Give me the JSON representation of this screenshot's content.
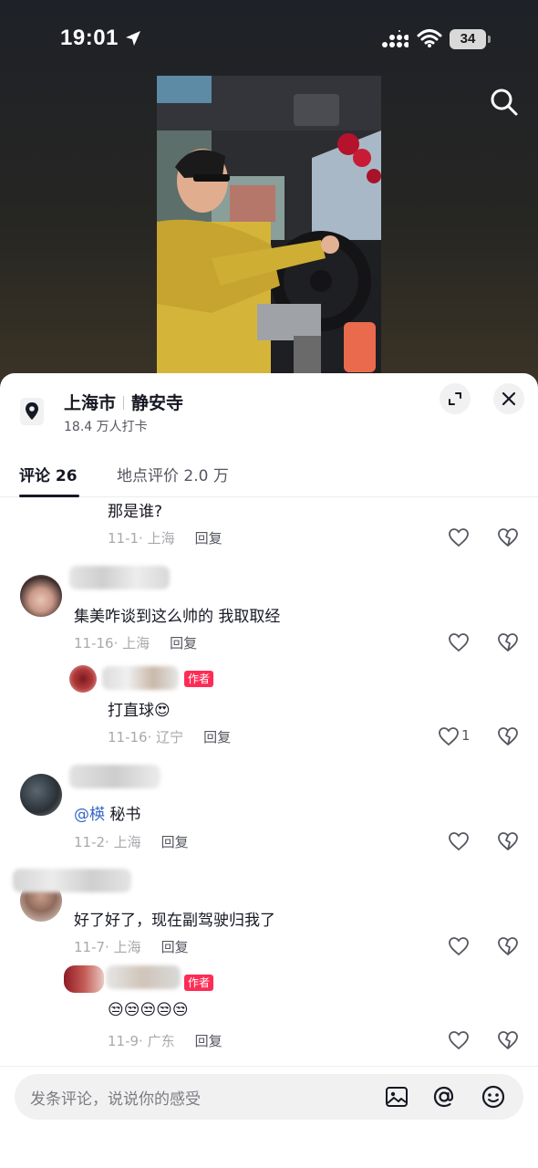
{
  "status": {
    "time": "19:01",
    "battery": "34"
  },
  "location": {
    "city": "上海市",
    "place": "静安寺",
    "checkins": "18.4 万人打卡"
  },
  "tabs": [
    {
      "label": "评论 26",
      "active": true
    },
    {
      "label": "地点评价 2.0 万",
      "active": false
    }
  ],
  "comments": [
    {
      "text": "那是谁?",
      "meta_date": "11-1",
      "meta_region": "上海",
      "reply_label": "回复"
    },
    {
      "text": "集美咋谈到这么帅的 我取取经",
      "meta_date": "11-16",
      "meta_region": "上海",
      "reply_label": "回复"
    },
    {
      "text": "打直球",
      "emoji": "😍",
      "badge": "作者",
      "meta_date": "11-16",
      "meta_region": "辽宁",
      "reply_label": "回复",
      "likes": "1"
    },
    {
      "mention": "@楧",
      "text": " 秘书",
      "meta_date": "11-2",
      "meta_region": "上海",
      "reply_label": "回复"
    },
    {
      "text": "好了好了，现在副驾驶归我了",
      "meta_date": "11-7",
      "meta_region": "上海",
      "reply_label": "回复"
    },
    {
      "emoji": "😒😒😒😒😒",
      "badge": "作者",
      "meta_date": "11-9",
      "meta_region": "广东",
      "reply_label": "回复"
    }
  ],
  "input": {
    "placeholder": "发条评论，说说你的感受"
  },
  "colors": {
    "accent": "#fe2c55",
    "mention": "#3266c6",
    "text": "#161823",
    "meta": "#a8a9ae"
  },
  "icons": [
    "location-pin-icon",
    "expand-icon",
    "close-icon",
    "search-icon",
    "heart-icon",
    "dislike-heart-icon",
    "image-icon",
    "at-icon",
    "emoji-icon"
  ]
}
